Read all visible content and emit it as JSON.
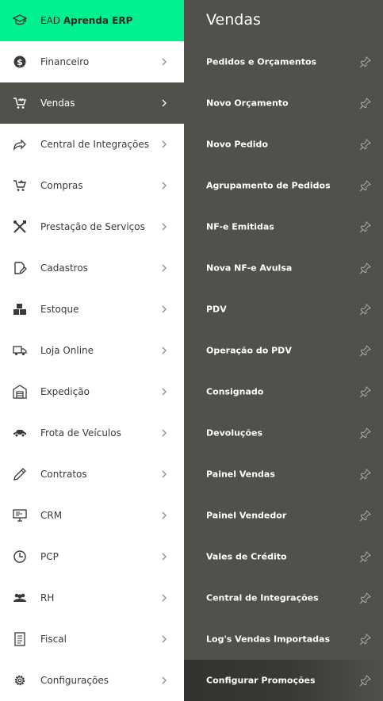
{
  "sidebar": {
    "header": {
      "prefix": "EAD",
      "brand": "Aprenda ERP",
      "icon": "graduation-cap-icon"
    },
    "items": [
      {
        "label": "Financeiro",
        "icon": "dollar-circle-icon"
      },
      {
        "label": "Vendas",
        "icon": "cart-icon"
      },
      {
        "label": "Central de Integrações",
        "icon": "share-arrow-icon"
      },
      {
        "label": "Compras",
        "icon": "cart-icon"
      },
      {
        "label": "Prestação de Serviços",
        "icon": "tools-icon"
      },
      {
        "label": "Cadastros",
        "icon": "edit-icon"
      },
      {
        "label": "Estoque",
        "icon": "boxes-icon"
      },
      {
        "label": "Loja Online",
        "icon": "truck-icon"
      },
      {
        "label": "Expedição",
        "icon": "warehouse-icon"
      },
      {
        "label": "Frota de Veículos",
        "icon": "car-icon"
      },
      {
        "label": "Contratos",
        "icon": "pen-icon"
      },
      {
        "label": "CRM",
        "icon": "monitor-icon"
      },
      {
        "label": "PCP",
        "icon": "clock-icon"
      },
      {
        "label": "RH",
        "icon": "users-icon"
      },
      {
        "label": "Fiscal",
        "icon": "document-icon"
      },
      {
        "label": "Configurações",
        "icon": "gear-icon"
      }
    ]
  },
  "panel": {
    "title": "Vendas",
    "items": [
      {
        "label": "Pedidos e Orçamentos"
      },
      {
        "label": "Novo Orçamento"
      },
      {
        "label": "Novo Pedido"
      },
      {
        "label": "Agrupamento de Pedidos"
      },
      {
        "label": "NF-e Emitidas"
      },
      {
        "label": "Nova NF-e Avulsa"
      },
      {
        "label": "PDV"
      },
      {
        "label": "Operação do PDV"
      },
      {
        "label": "Consignado"
      },
      {
        "label": "Devoluções"
      },
      {
        "label": "Painel Vendas"
      },
      {
        "label": "Painel Vendedor"
      },
      {
        "label": "Vales de Crédito"
      },
      {
        "label": "Central de Integrações"
      },
      {
        "label": "Log's Vendas Importadas"
      },
      {
        "label": "Configurar Promoções"
      }
    ]
  },
  "colors": {
    "accent": "#00f08f",
    "panel_bg": "#52504a",
    "active_bg": "#52504a",
    "pin": "#a9a8a3"
  }
}
